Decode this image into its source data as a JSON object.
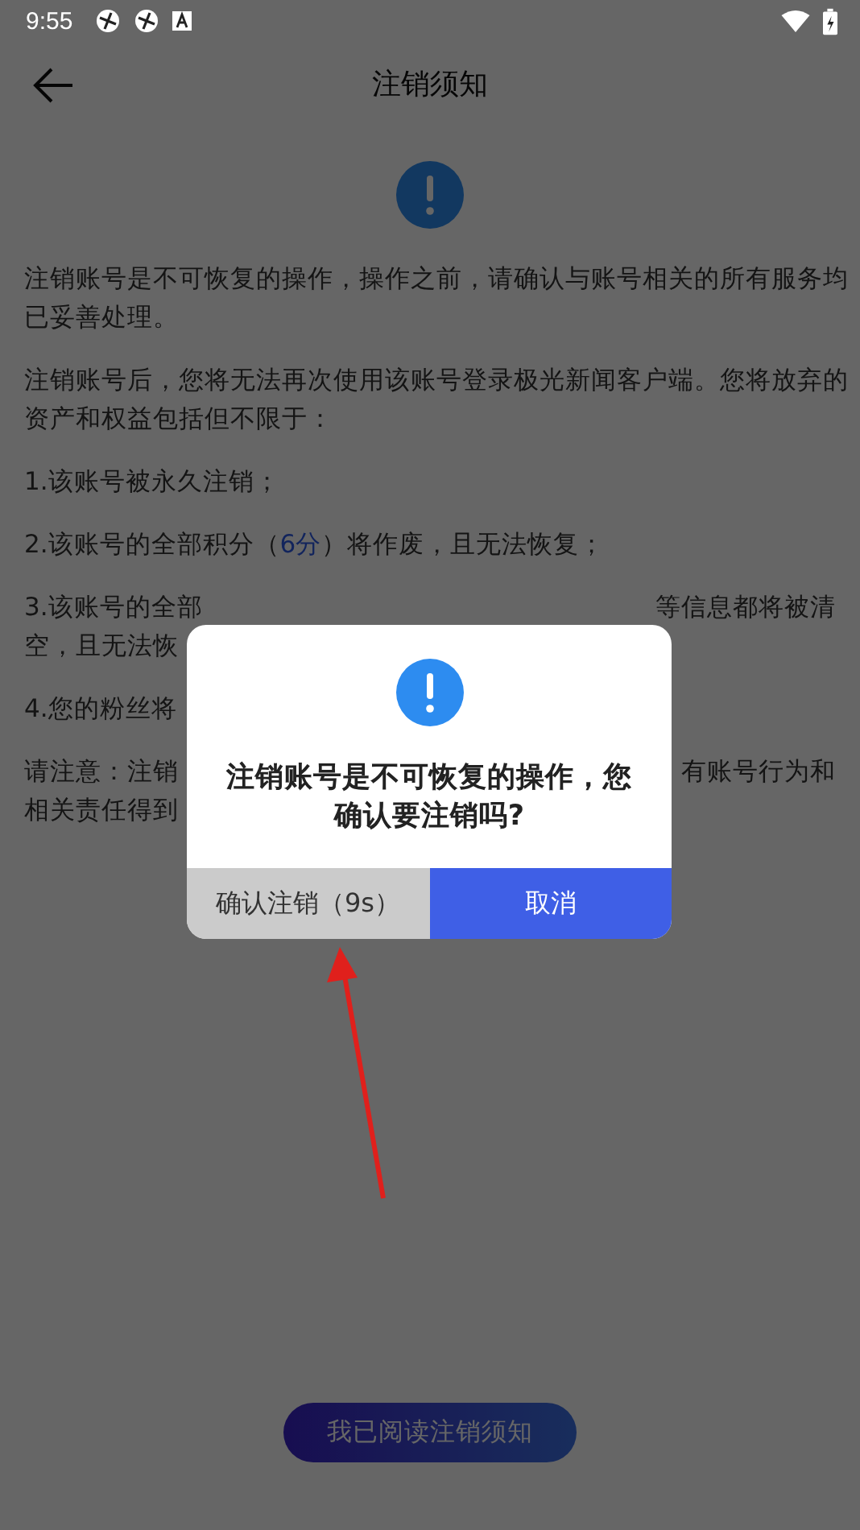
{
  "status_bar": {
    "time": "9:55"
  },
  "app_bar": {
    "title": "注销须知"
  },
  "notice": {
    "paragraphs": [
      {
        "lines": [
          {
            "parts": [
              {
                "text": "注销账号是不可恢复的操作，操作之前，请确认与账号相关的所有服务均",
                "kind": "plain"
              }
            ]
          },
          {
            "parts": [
              {
                "text": "已妥善处理。",
                "kind": "plain"
              }
            ]
          }
        ]
      },
      {
        "lines": [
          {
            "parts": [
              {
                "text": " 注销账号后，您将无法再次使用该账号登录极光新闻客户端。您将放弃的",
                "kind": "plain"
              }
            ]
          },
          {
            "parts": [
              {
                "text": "资产和权益包括但不限于：",
                "kind": "plain"
              }
            ]
          }
        ]
      },
      {
        "lines": [
          {
            "parts": [
              {
                "text": " 1.该账号被永久注销；",
                "kind": "plain"
              }
            ]
          }
        ]
      },
      {
        "lines": [
          {
            "parts": [
              {
                "text": " 2.该账号的全部积分（",
                "kind": "plain"
              },
              {
                "text": "6分",
                "kind": "highlight"
              },
              {
                "text": "）将作废，且无法恢复；",
                "kind": "plain"
              }
            ]
          }
        ]
      },
      {
        "lines": [
          {
            "parts": [
              {
                "text": " 3.该账号的全部",
                "kind": "plain"
              }
            ],
            "right": "等信息都将被清"
          },
          {
            "parts": [
              {
                "text": "空，且无法恢",
                "kind": "plain"
              }
            ]
          }
        ]
      },
      {
        "lines": [
          {
            "parts": [
              {
                "text": " 4.您的粉丝将",
                "kind": "plain"
              }
            ]
          }
        ]
      },
      {
        "lines": [
          {
            "parts": [
              {
                "text": " 请注意：注销",
                "kind": "plain"
              }
            ],
            "right": "有账号行为和"
          },
          {
            "parts": [
              {
                "text": "相关责任得到",
                "kind": "plain"
              }
            ]
          }
        ]
      }
    ]
  },
  "read_button": {
    "label": "我已阅读注销须知"
  },
  "dialog": {
    "message": "注销账号是不可恢复的操作，您确认要注销吗?",
    "buttons": [
      {
        "label": "确认注销（9s）",
        "kind": "confirm",
        "disabled": true
      },
      {
        "label": "取消",
        "kind": "cancel",
        "disabled": false
      }
    ]
  }
}
